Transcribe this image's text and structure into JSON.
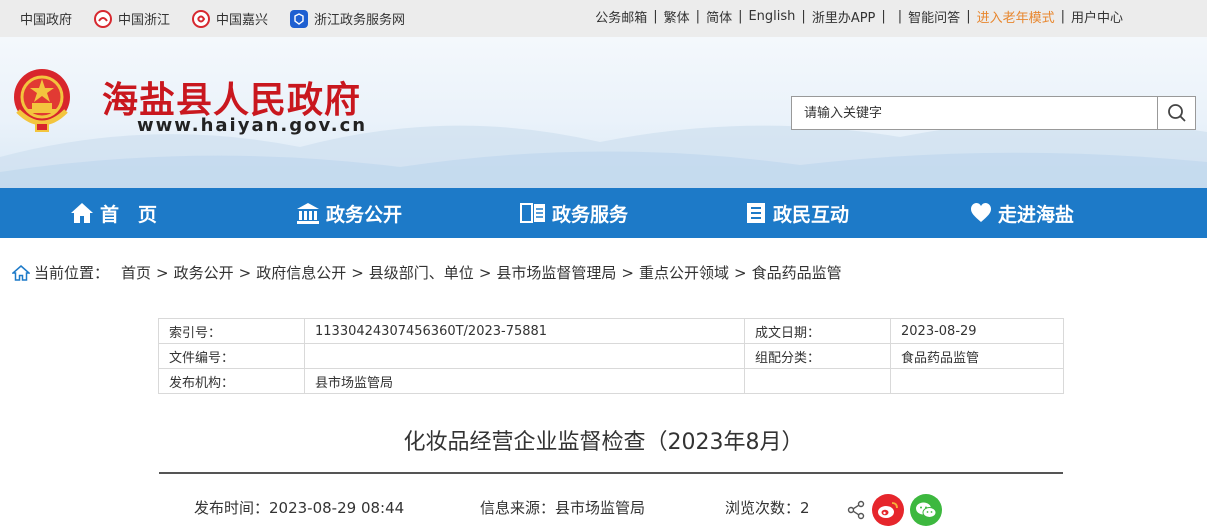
{
  "topbar": {
    "left_links": [
      {
        "label": "中国政府",
        "icon": "china-gov-icon"
      },
      {
        "label": "中国浙江",
        "icon": "zhejiang-icon"
      },
      {
        "label": "中国嘉兴",
        "icon": "jiaxing-icon"
      },
      {
        "label": "浙江政务服务网",
        "icon": "zjzwfw-icon"
      }
    ],
    "right_links": [
      "公务邮箱",
      "繁体",
      "简体",
      "English",
      "浙里办APP",
      "",
      "智能问答",
      "进入老年模式",
      "用户中心"
    ]
  },
  "header": {
    "title": "海盐县人民政府",
    "url": "www.haiyan.gov.cn",
    "search_placeholder": "请输入关键字"
  },
  "nav": [
    "首　页",
    "政务公开",
    "政务服务",
    "政民互动",
    "走进海盐"
  ],
  "breadcrumb": {
    "prefix": "当前位置：",
    "items": [
      "首页",
      "政务公开",
      "政府信息公开",
      "县级部门、单位",
      "县市场监督管理局",
      "重点公开领域",
      "食品药品监管"
    ]
  },
  "meta": {
    "index_label": "索引号：",
    "index_value": "11330424307456360T/2023-75881",
    "date_label": "成文日期：",
    "date_value": "2023-08-29",
    "docno_label": "文件编号：",
    "docno_value": "",
    "category_label": "组配分类：",
    "category_value": "食品药品监管",
    "org_label": "发布机构：",
    "org_value": "县市场监管局"
  },
  "article": {
    "title": "化妆品经营企业监督检查（2023年8月）",
    "publish_time": "发布时间：2023-08-29 08:44",
    "source": "信息来源：县市场监管局",
    "views": "浏览次数：2"
  },
  "colors": {
    "nav_bg": "#1d7ac8",
    "title_red": "#c9171e",
    "elder_orange": "#e8872f",
    "weibo_red": "#e6262c",
    "wechat_green": "#3db83f"
  }
}
